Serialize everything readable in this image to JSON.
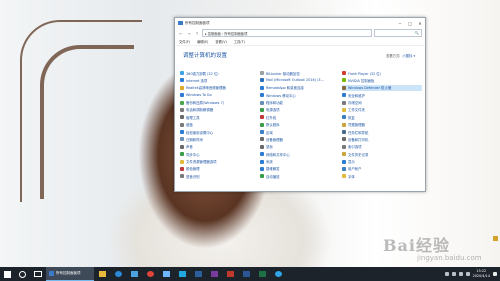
{
  "window": {
    "title": "所有控制面板项",
    "controls": {
      "minimize": "─",
      "maximize": "□",
      "close": "✕"
    }
  },
  "address": {
    "back": "←",
    "forward": "→",
    "up": "↑",
    "path": "▸ 控制面板 › 所有控制面板项",
    "search_placeholder": "🔍"
  },
  "menu": [
    "文件(F)",
    "编辑(E)",
    "查看(V)",
    "工具(T)"
  ],
  "header": {
    "title": "调整计算机的设置",
    "view_by_label": "查看方式:",
    "view_by_value": "小图标 ▾"
  },
  "items": [
    {
      "label": "360强力卸载 (32 位)",
      "color": "#3ca5e8"
    },
    {
      "label": "BitLocker 驱动器加密",
      "color": "#9aa0a6"
    },
    {
      "label": "Flash Player (32 位)",
      "color": "#d23c2e"
    },
    {
      "label": "Internet 选项",
      "color": "#2b7cd3"
    },
    {
      "label": "Mail (Microsoft Outlook 2016) (3...",
      "color": "#2f6fb7"
    },
    {
      "label": "NVIDIA 控制面板",
      "color": "#76b900"
    },
    {
      "label": "Realtek高清晰音频管理器",
      "color": "#e1a82b"
    },
    {
      "label": "RemoteApp 和桌面连接",
      "color": "#2b7cd3"
    },
    {
      "label": "Windows Defender 防火墙",
      "color": "#8b6b3e",
      "selected": true
    },
    {
      "label": "Windows To Go",
      "color": "#2b7cd3"
    },
    {
      "label": "Windows 移动中心",
      "color": "#2b7cd3"
    },
    {
      "label": "安全和维护",
      "color": "#2b7cd3"
    },
    {
      "label": "备份和还原(Windows 7)",
      "color": "#4ca64c"
    },
    {
      "label": "程序和功能",
      "color": "#6a8fb5"
    },
    {
      "label": "存储空间",
      "color": "#7a7a7a"
    },
    {
      "label": "电话和调制解调器",
      "color": "#7a7a7a"
    },
    {
      "label": "电源选项",
      "color": "#3a9c4a"
    },
    {
      "label": "工作文件夹",
      "color": "#e2b93b"
    },
    {
      "label": "管理工具",
      "color": "#6a6a6a"
    },
    {
      "label": "红外线",
      "color": "#c03a3a"
    },
    {
      "label": "恢复",
      "color": "#3b7fc4"
    },
    {
      "label": "键盘",
      "color": "#7a7a7a"
    },
    {
      "label": "默认程序",
      "color": "#3a9c4a"
    },
    {
      "label": "凭据管理器",
      "color": "#c9a43b"
    },
    {
      "label": "轻松使用设置中心",
      "color": "#2b7cd3"
    },
    {
      "label": "区域",
      "color": "#3b7fc4"
    },
    {
      "label": "任务栏和导航",
      "color": "#4a6a8a"
    },
    {
      "label": "日期和时间",
      "color": "#6a8fb5"
    },
    {
      "label": "设备管理器",
      "color": "#6a6a6a"
    },
    {
      "label": "设备和打印机",
      "color": "#6a6a6a"
    },
    {
      "label": "声音",
      "color": "#6a6a6a"
    },
    {
      "label": "鼠标",
      "color": "#6a6a6a"
    },
    {
      "label": "索引选项",
      "color": "#7a7a7a"
    },
    {
      "label": "同步中心",
      "color": "#3a9c4a"
    },
    {
      "label": "网络和共享中心",
      "color": "#2b7cd3"
    },
    {
      "label": "文件历史记录",
      "color": "#c9a43b"
    },
    {
      "label": "文件资源管理器选项",
      "color": "#e2b93b"
    },
    {
      "label": "系统",
      "color": "#2b7cd3"
    },
    {
      "label": "显示",
      "color": "#2b7cd3"
    },
    {
      "label": "颜色管理",
      "color": "#c03a3a"
    },
    {
      "label": "疑难解答",
      "color": "#2b7cd3"
    },
    {
      "label": "用户帐户",
      "color": "#3b7fc4"
    },
    {
      "label": "语音识别",
      "color": "#7a7a7a"
    },
    {
      "label": "自动播放",
      "color": "#3a9c4a"
    },
    {
      "label": "字体",
      "color": "#e2b93b"
    }
  ],
  "taskbar": {
    "active_task": "所有控制面板项",
    "time": "15:22",
    "date": "2020/4/14"
  },
  "watermark": {
    "brand": "Bai经验",
    "url": "jingyan.baidu.com"
  }
}
